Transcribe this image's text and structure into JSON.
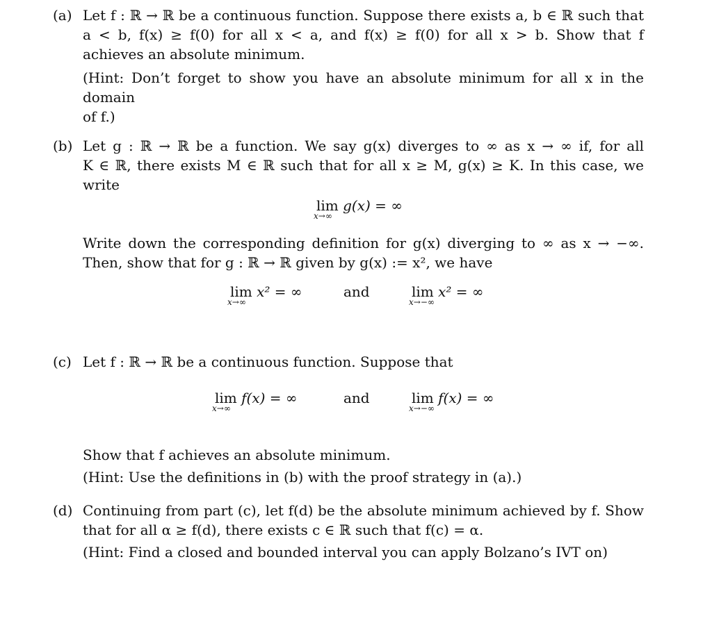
{
  "problems": {
    "a": {
      "label": "(a)",
      "lines": [
        "Let f : ℝ → ℝ be a continuous function. Suppose there exists a, b ∈ ℝ such that",
        "a < b, f(x) ≥ f(0) for all x < a, and f(x) ≥ f(0) for all x > b. Show that f",
        "achieves an absolute minimum."
      ],
      "hint_lines": [
        "(Hint: Don’t forget to show you have an absolute minimum for all x in the domain",
        "of f.)"
      ]
    },
    "b": {
      "label": "(b)",
      "lines": [
        "Let g : ℝ → ℝ be a function. We say g(x) diverges to ∞ as x → ∞ if, for all",
        "K ∈ ℝ, there exists M ∈ ℝ such that for all x ≥ M, g(x) ≥ K. In this case, we",
        "write"
      ],
      "display1": {
        "lim": "lim",
        "sub": "x→∞",
        "expr": "g(x) = ∞"
      },
      "lines2": [
        "Write down the corresponding definition for g(x) diverging to ∞ as x → −∞.",
        "Then, show that for g : ℝ → ℝ given by g(x) := x², we have"
      ],
      "display2": {
        "left": {
          "lim": "lim",
          "sub": "x→∞",
          "expr": "x² = ∞"
        },
        "conj": "and",
        "right": {
          "lim": "lim",
          "sub": "x→−∞",
          "expr": "x² = ∞"
        }
      }
    },
    "c": {
      "label": "(c)",
      "lines": [
        "Let f : ℝ → ℝ be a continuous function. Suppose that"
      ],
      "display": {
        "left": {
          "lim": "lim",
          "sub": "x→∞",
          "expr": "f(x) = ∞"
        },
        "conj": "and",
        "right": {
          "lim": "lim",
          "sub": "x→−∞",
          "expr": "f(x) = ∞"
        }
      },
      "lines2": [
        "Show that f achieves an absolute minimum."
      ],
      "hint_lines": [
        "(Hint: Use the definitions in (b) with the proof strategy in (a).)"
      ]
    },
    "d": {
      "label": "(d)",
      "lines": [
        "Continuing from part (c), let f(d) be the absolute minimum achieved by f. Show",
        "that for all α ≥ f(d), there exists c ∈ ℝ such that f(c) = α."
      ],
      "hint_lines": [
        "(Hint: Find a closed and bounded interval you can apply Bolzano’s IVT on)"
      ]
    }
  }
}
